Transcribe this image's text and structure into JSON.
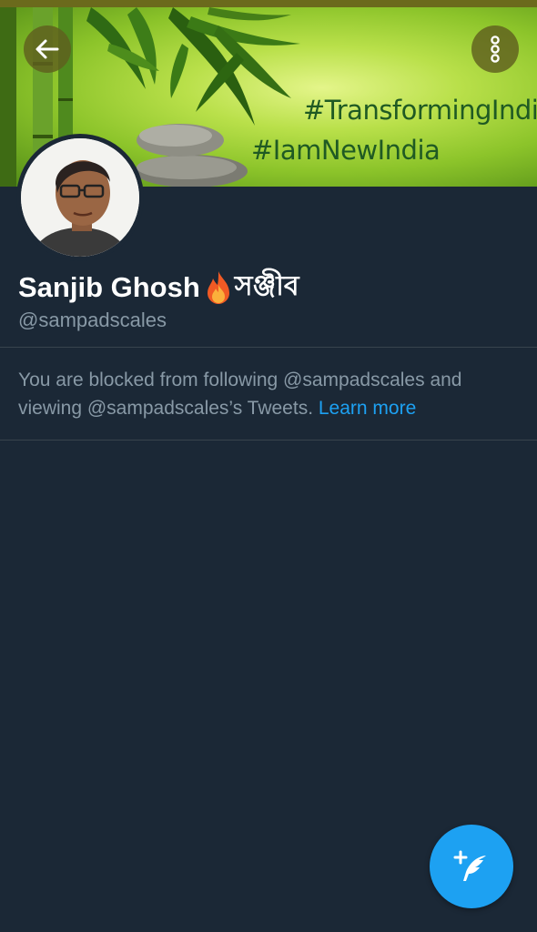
{
  "banner": {
    "hashtag_1": "#TransformingIndia",
    "hashtag_2": "#IamNewIndia"
  },
  "header": {
    "back_icon": "arrow-left-icon",
    "more_icon": "more-vertical-icon"
  },
  "profile": {
    "name": "Sanjib Ghosh",
    "name_emoji": "fire-emoji",
    "name_bengali": "সঞ্জীব",
    "handle": "@sampadscales"
  },
  "blocked_notice": {
    "text": "You are blocked from following @sampadscales and viewing @sampadscales’s Tweets.",
    "link": "Learn more"
  },
  "fab": {
    "icon": "compose-tweet-icon"
  },
  "colors": {
    "background": "#1b2836",
    "accent": "#1da1f2",
    "secondary_text": "#8899a6",
    "divider": "#38444d"
  }
}
